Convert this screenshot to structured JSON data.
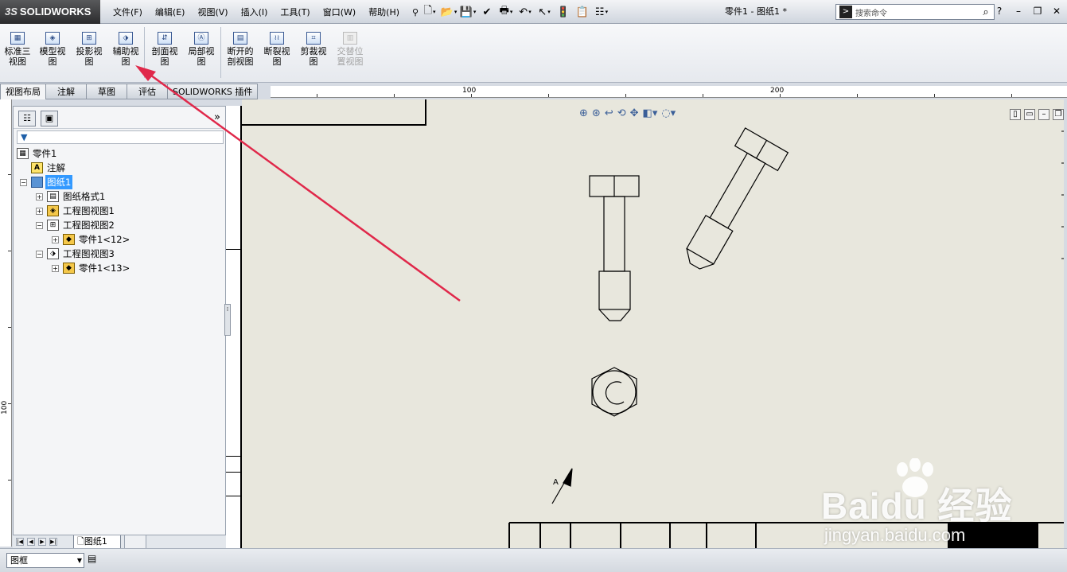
{
  "app": {
    "logo_text": "SOLIDWORKS",
    "doc_title": "零件1 - 图纸1 *"
  },
  "menu": [
    "文件(F)",
    "编辑(E)",
    "视图(V)",
    "插入(I)",
    "工具(T)",
    "窗口(W)",
    "帮助(H)"
  ],
  "search": {
    "placeholder": "搜索命令"
  },
  "toolbar": [
    {
      "label": "标准三视图",
      "l1": "标准三",
      "l2": "视图",
      "icon": "standard-3-view-icon"
    },
    {
      "label": "模型视图",
      "l1": "模型视",
      "l2": "图",
      "icon": "model-view-icon"
    },
    {
      "label": "投影视图",
      "l1": "投影视",
      "l2": "图",
      "icon": "projected-view-icon"
    },
    {
      "label": "辅助视图",
      "l1": "辅助视",
      "l2": "图",
      "icon": "auxiliary-view-icon"
    },
    {
      "label": "剖面视图",
      "l1": "剖面视",
      "l2": "图",
      "icon": "section-view-icon"
    },
    {
      "label": "局部视图",
      "l1": "局部视",
      "l2": "图",
      "icon": "detail-view-icon"
    },
    {
      "label": "断开的剖视图",
      "l1": "断开的",
      "l2": "剖视图",
      "icon": "broken-out-section-icon"
    },
    {
      "label": "断裂视图",
      "l1": "断裂视",
      "l2": "图",
      "icon": "break-view-icon"
    },
    {
      "label": "剪裁视图",
      "l1": "剪裁视",
      "l2": "图",
      "icon": "crop-view-icon"
    },
    {
      "label": "交替位置视图",
      "l1": "交替位",
      "l2": "置视图",
      "icon": "alternate-position-view-icon",
      "disabled": true
    }
  ],
  "tabs": [
    "视图布局",
    "注解",
    "草图",
    "评估",
    "SOLIDWORKS 插件"
  ],
  "ruler": {
    "top_labels": [
      "100",
      "200"
    ],
    "left_label": "100"
  },
  "tree": {
    "root": "零件1",
    "items": [
      {
        "label": "注解"
      },
      {
        "label": "图纸1"
      },
      {
        "label": "图纸格式1"
      },
      {
        "label": "工程图视图1"
      },
      {
        "label": "工程图视图2"
      },
      {
        "label": "零件1<12>"
      },
      {
        "label": "工程图视图3"
      },
      {
        "label": "零件1<13>"
      }
    ]
  },
  "sheet_tab": "图纸1",
  "status": {
    "layer": "图框"
  },
  "drawing": {
    "arrow_label": "A",
    "annotation_arrow_color": "#e0284a"
  },
  "watermark": {
    "brand": "Baidu 经验",
    "site": "jingyan.baidu.com"
  }
}
